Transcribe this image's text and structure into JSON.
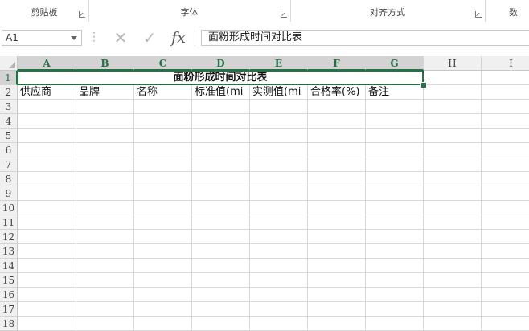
{
  "ribbon": {
    "groups": [
      {
        "label": "剪贴板"
      },
      {
        "label": "字体"
      },
      {
        "label": "对齐方式"
      },
      {
        "label": "数"
      }
    ]
  },
  "formula_bar": {
    "name_box": "A1",
    "cancel_glyph": "✕",
    "enter_glyph": "✓",
    "fx_label": "fx",
    "content": "面粉形成时间对比表"
  },
  "columns": [
    "A",
    "B",
    "C",
    "D",
    "E",
    "F",
    "G",
    "H",
    "I"
  ],
  "rows": [
    "1",
    "2",
    "3",
    "4",
    "5",
    "6",
    "7",
    "8",
    "9",
    "10",
    "11",
    "12",
    "13",
    "14",
    "15",
    "16",
    "17",
    "18"
  ],
  "sheet": {
    "title": "面粉形成时间对比表",
    "headers": [
      "供应商",
      "品牌",
      "名称",
      "标准值(mi",
      "实测值(mi",
      "合格率(%)",
      "备注"
    ]
  },
  "icons": {
    "cancel": "close-icon",
    "enter": "check-icon",
    "function": "function-icon",
    "dropdown": "chevron-down-icon"
  },
  "colors": {
    "accent": "#217346",
    "header_bg": "#f0f0f0",
    "selected_header_bg": "#d3d3d3"
  }
}
